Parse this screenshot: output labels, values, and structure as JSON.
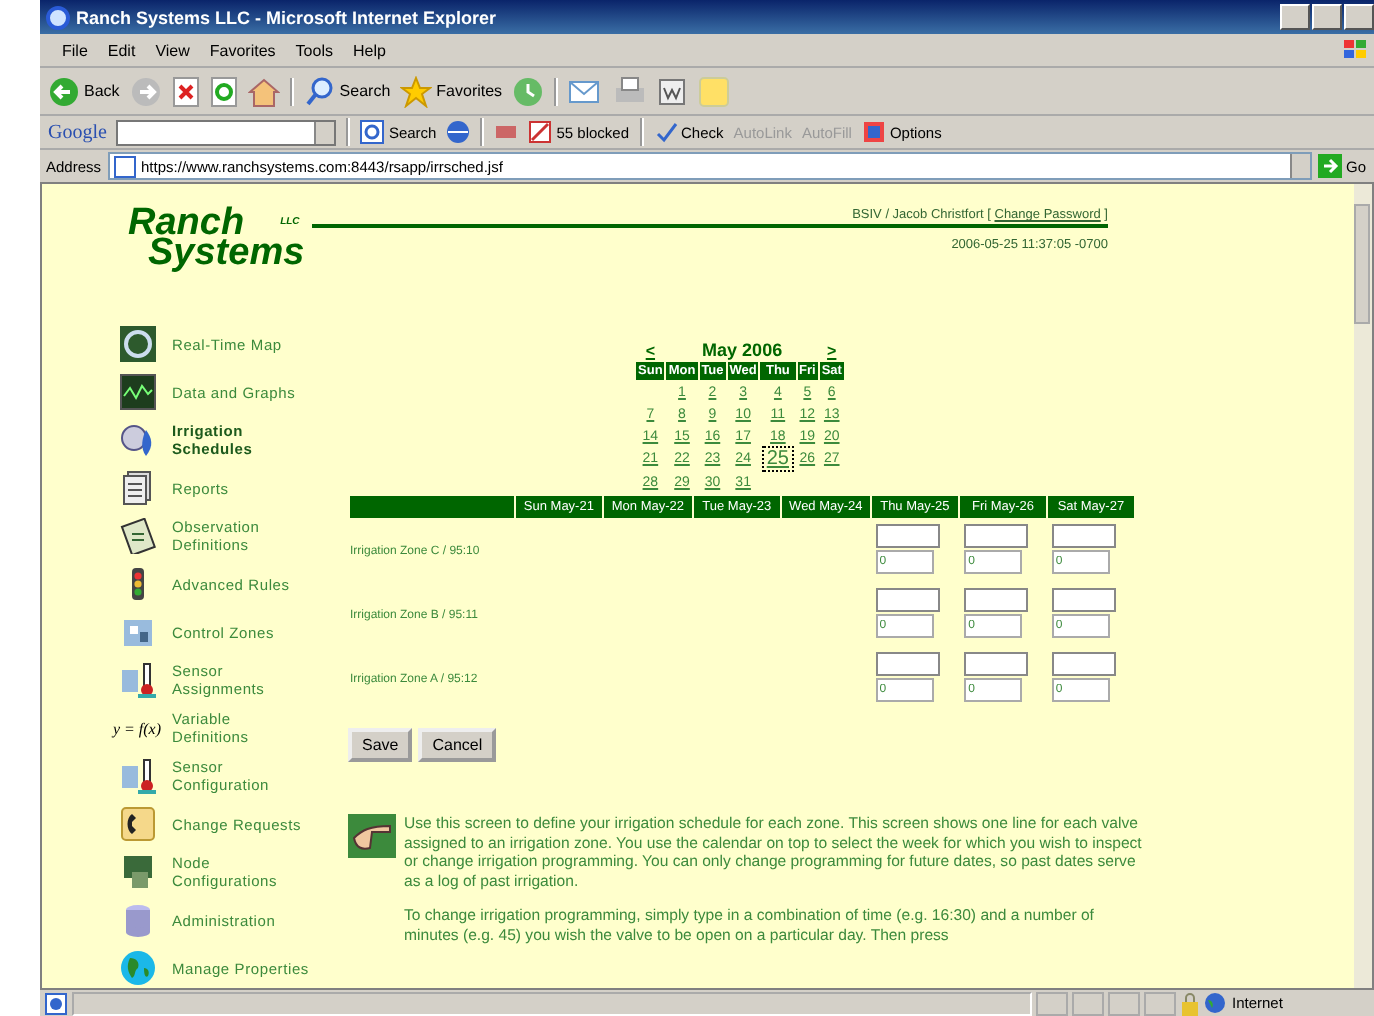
{
  "window": {
    "title": "Ranch Systems LLC - Microsoft Internet Explorer"
  },
  "menu_bar": [
    "File",
    "Edit",
    "View",
    "Favorites",
    "Tools",
    "Help"
  ],
  "toolbar": {
    "back": "Back",
    "search": "Search",
    "favorites": "Favorites"
  },
  "google_bar": {
    "logo": "Google",
    "search": "Search",
    "blocked": "55 blocked",
    "check": "Check",
    "autolink": {
      "label": "AutoLink",
      "disabled": true
    },
    "autofill": {
      "label": "AutoFill",
      "disabled": true
    },
    "options": "Options"
  },
  "address_bar": {
    "label": "Address",
    "url": "https://www.ranchsystems.com:8443/rsapp/irrsched.jsf",
    "go": "Go"
  },
  "header": {
    "logo_top": "Ranch",
    "logo_mark": "LLC",
    "logo_bottom": "Systems",
    "user": "BSIV / Jacob Christfort [",
    "password_link": "Change Password",
    "user_end": "]",
    "timestamp": "2006-05-25 11:37:05 -0700"
  },
  "nav": [
    {
      "label": "Real-Time Map",
      "selected": false
    },
    {
      "label": "Data and Graphs",
      "selected": false
    },
    {
      "label": "Irrigation Schedules",
      "selected": true
    },
    {
      "label": "Reports",
      "selected": false
    },
    {
      "label": "Observation Definitions",
      "selected": false
    },
    {
      "label": "Advanced Rules",
      "selected": false
    },
    {
      "label": "Control Zones",
      "selected": false
    },
    {
      "label": "Sensor Assignments",
      "selected": false
    },
    {
      "label": "Variable Definitions",
      "selected": false,
      "icon_text": "y = f(x)"
    },
    {
      "label": "Sensor Configuration",
      "selected": false
    },
    {
      "label": "Change Requests",
      "selected": false
    },
    {
      "label": "Node Configurations",
      "selected": false
    },
    {
      "label": "Administration",
      "selected": false
    },
    {
      "label": "Manage Properties",
      "selected": false
    }
  ],
  "calendar": {
    "prev": "<",
    "title": "May 2006",
    "next": ">",
    "weekdays": [
      "Sun",
      "Mon",
      "Tue",
      "Wed",
      "Thu",
      "Fri",
      "Sat"
    ],
    "weeks": [
      {
        "starts_mid_week": true,
        "days": [
          {
            "day": "1",
            "selected": false
          },
          {
            "day": "2",
            "selected": false
          },
          {
            "day": "3",
            "selected": false
          },
          {
            "day": "4",
            "selected": false
          },
          {
            "day": "5",
            "selected": false
          },
          {
            "day": "6",
            "selected": false
          }
        ]
      },
      {
        "days": [
          {
            "day": "7",
            "selected": false
          },
          {
            "day": "8",
            "selected": false
          },
          {
            "day": "9",
            "selected": false
          },
          {
            "day": "10",
            "selected": false
          },
          {
            "day": "11",
            "selected": false
          },
          {
            "day": "12",
            "selected": false
          },
          {
            "day": "13",
            "selected": false
          }
        ]
      },
      {
        "days": [
          {
            "day": "14",
            "selected": false
          },
          {
            "day": "15",
            "selected": false
          },
          {
            "day": "16",
            "selected": false
          },
          {
            "day": "17",
            "selected": false
          },
          {
            "day": "18",
            "selected": false
          },
          {
            "day": "19",
            "selected": false
          },
          {
            "day": "20",
            "selected": false
          }
        ]
      },
      {
        "days": [
          {
            "day": "21",
            "selected": false
          },
          {
            "day": "22",
            "selected": false
          },
          {
            "day": "23",
            "selected": false
          },
          {
            "day": "24",
            "selected": false
          },
          {
            "day": "25",
            "selected": true
          },
          {
            "day": "26",
            "selected": false
          },
          {
            "day": "27",
            "selected": false
          }
        ]
      },
      {
        "starts_mid_week": false,
        "days": [
          {
            "day": "28",
            "selected": false
          },
          {
            "day": "29",
            "selected": false
          },
          {
            "day": "30",
            "selected": false
          },
          {
            "day": "31",
            "selected": false
          }
        ]
      }
    ]
  },
  "schedule": {
    "columns": [
      {
        "label": "Sun May-21",
        "editable": false
      },
      {
        "label": "Mon May-22",
        "editable": false
      },
      {
        "label": "Tue May-23",
        "editable": false
      },
      {
        "label": "Wed May-24",
        "editable": false
      },
      {
        "label": "Thu May-25",
        "editable": true
      },
      {
        "label": "Fri May-26",
        "editable": true
      },
      {
        "label": "Sat May-27",
        "editable": true
      }
    ],
    "rows": [
      {
        "zone": "Irrigation Zone C / 95:10",
        "minutes": [
          "0",
          "0",
          "0"
        ]
      },
      {
        "zone": "Irrigation Zone B / 95:11",
        "minutes": [
          "0",
          "0",
          "0"
        ]
      },
      {
        "zone": "Irrigation Zone A / 95:12",
        "minutes": [
          "0",
          "0",
          "0"
        ]
      }
    ]
  },
  "buttons": [
    "Save",
    "Cancel"
  ],
  "help": [
    "Use this screen to define your irrigation schedule for each zone. This screen shows one line for each valve assigned to an irrigation zone. You use the calendar on top to select the week for which you wish to inspect or change irrigation programming. You can only change programming for future dates, so past dates serve as a log of past irrigation.",
    "To change irrigation programming, simply type in a combination of time (e.g. 16:30) and a number of minutes (e.g. 45) you wish the valve to be open on a particular day. Then press"
  ],
  "status_bar": {
    "zone": "Internet"
  }
}
